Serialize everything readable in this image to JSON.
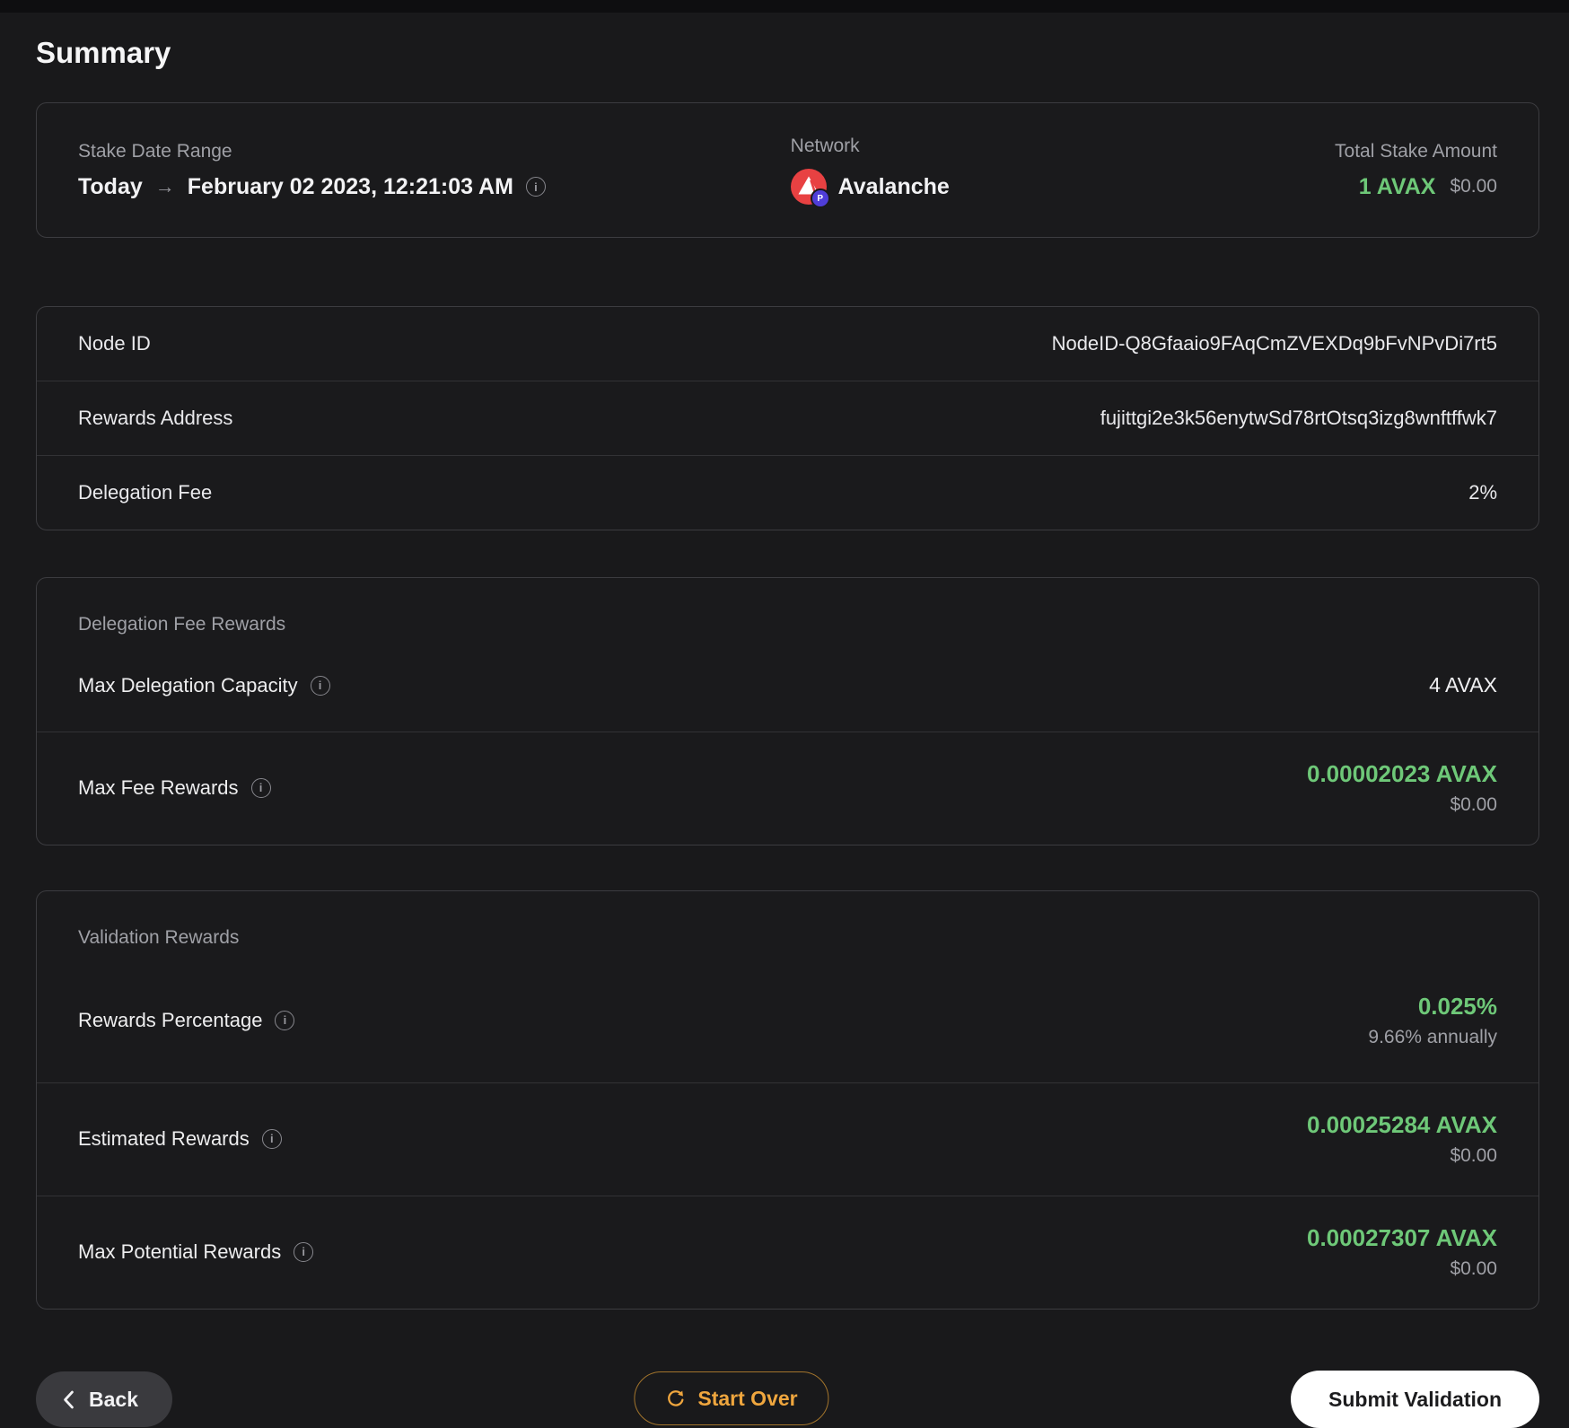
{
  "header": {
    "title": "Summary"
  },
  "colors": {
    "background": "#19191b",
    "accent_green": "#6ec878",
    "accent_orange": "#efa63e",
    "avalanche_red": "#e84142",
    "pchain_purple": "#4f3dd8"
  },
  "overview": {
    "stake_date_range": {
      "label": "Stake Date Range",
      "from": "Today",
      "arrow": "→",
      "to": "February 02 2023, 12:21:03 AM",
      "info_icon": "info-icon"
    },
    "network": {
      "label": "Network",
      "value": "Avalanche",
      "icon": "avalanche-icon",
      "badge_letter": "P"
    },
    "total_stake": {
      "label": "Total Stake Amount",
      "amount": "1 AVAX",
      "usd": "$0.00"
    }
  },
  "details": {
    "rows": [
      {
        "label": "Node ID",
        "value": "NodeID-Q8Gfaaio9FAqCmZVEXDq9bFvNPvDi7rt5"
      },
      {
        "label": "Rewards Address",
        "value": "fujittgi2e3k56enytwSd78rtOtsq3izg8wnftffwk7"
      },
      {
        "label": "Delegation Fee",
        "value": "2%"
      }
    ]
  },
  "delegation_fee_rewards": {
    "title": "Delegation Fee Rewards",
    "max_delegation_capacity": {
      "label": "Max Delegation Capacity",
      "value": "4 AVAX"
    },
    "max_fee_rewards": {
      "label": "Max Fee Rewards",
      "value": "0.00002023 AVAX",
      "usd": "$0.00"
    }
  },
  "validation_rewards": {
    "title": "Validation Rewards",
    "rewards_percentage": {
      "label": "Rewards Percentage",
      "value": "0.025%",
      "sub": "9.66% annually"
    },
    "estimated_rewards": {
      "label": "Estimated Rewards",
      "value": "0.00025284 AVAX",
      "usd": "$0.00"
    },
    "max_potential_rewards": {
      "label": "Max Potential Rewards",
      "value": "0.00027307 AVAX",
      "usd": "$0.00"
    }
  },
  "footer": {
    "back_label": "Back",
    "start_over_label": "Start Over",
    "submit_label": "Submit Validation"
  }
}
